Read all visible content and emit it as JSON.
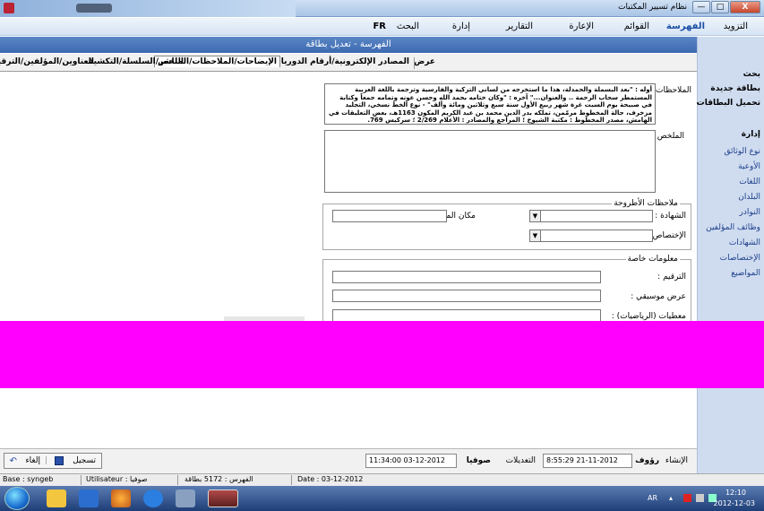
{
  "window": {
    "title": "نظام تسيير المكتبات",
    "minimize": "—",
    "maximize": "□",
    "close": "X"
  },
  "menu": {
    "items": [
      "التزويد",
      "الفهرسة",
      "القوائم",
      "الإعارة",
      "التقارير",
      "إدارة",
      "البحث",
      "FR"
    ],
    "active_index": 1
  },
  "panel": {
    "title": "الفهرسة - تعديل بطاقة"
  },
  "sidebar": {
    "items": [
      {
        "label": "بحث",
        "bold": true
      },
      {
        "label": "بطاقة جديدة",
        "bold": true
      },
      {
        "label": "تحميل البطاقات",
        "bold": true
      },
      {
        "label": "إدارة",
        "bold": true
      },
      {
        "label": "نوع الوثائق",
        "bold": false
      },
      {
        "label": "الأوعية",
        "bold": false
      },
      {
        "label": "اللغات",
        "bold": false
      },
      {
        "label": "البلدان",
        "bold": false
      },
      {
        "label": "النوادر",
        "bold": false
      },
      {
        "label": "وظائف المؤلفين",
        "bold": false
      },
      {
        "label": "الشهادات",
        "bold": false
      },
      {
        "label": "الإختصاصات",
        "bold": false
      },
      {
        "label": "المواضيع",
        "bold": false
      }
    ]
  },
  "tabs": [
    {
      "label": "عرض",
      "active": false
    },
    {
      "label": "المصادر الإلكترونية/أرقام الدوريات/النسخ",
      "active": false
    },
    {
      "label": "الإيضاحات/الملاحظات/الملخص",
      "active": true
    },
    {
      "label": "الناشر/السلسلة/التكشيف",
      "active": false
    },
    {
      "label": "العناوين/المؤلفين/الترقيم",
      "active": false
    }
  ],
  "form": {
    "notes_label": "الملاحظات :",
    "notes_text": "أوله : \"بعد البسملة والحمدلة، هذا ما استخرجه من لساني التركية والفارسية وترجمة باللغة العربية المستمطر سحاب الرحمة .. والعنوان...\" آخره : \"وكان ختامه بحمد الله وحسن عونه وتمامه جمعاً وكتابة في صبيحة يوم السبت غرة شهر ربيع الأول سنة سبع وثلاثين ومائة وألف\" - نوع الخط نسخي، التجليد مزخرف، حالة المخطوط مرمّمن، تملكه بدر الدين محمد بن عبد الكريم المكون 1163هـ، بعض التعليقات في الهامش، مصدر المخطوط : مكتبة الشيوخ ؛ المراجع والمصادر : الأعلام 2/269 ؛ سركيس 769.",
    "summary_label": "الملخص :",
    "thesis": {
      "legend": "ملاحظات الأطروحة",
      "degree_label": "الشهادة :",
      "place_label": "مكان المناقشة :",
      "specialty_label": "الإختصاص :"
    },
    "special": {
      "legend": "معلومات خاصة",
      "numbering_label": "الترقيم :",
      "music_label": "عرض موسيقي :",
      "math_label": "معطيات (الرياضيات) :"
    }
  },
  "actionbar": {
    "creation_label": "الإنشاء",
    "creation_user": "رؤوف",
    "creation_date": "8:55:29 21-11-2012",
    "modified_label": "التعديلات",
    "modified_user": "صوفيا",
    "modified_date": "11:34:00 03-12-2012",
    "save_label": "تسجيل",
    "cancel_label": "إلغاء"
  },
  "statusbar": {
    "base": "Base : syngeb",
    "user": "Utilisateur : صوفيا",
    "index": "الفهرس : 5172 بطاقة",
    "date": "Date : 03-12-2012"
  },
  "taskbar": {
    "lang": "AR",
    "time": "12:10",
    "date": "2012-12-03"
  }
}
